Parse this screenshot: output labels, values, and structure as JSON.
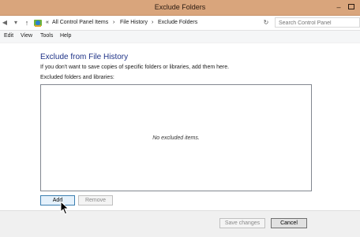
{
  "window": {
    "title": "Exclude Folders",
    "minimize_glyph": "–"
  },
  "nav": {
    "back_glyph": "◀",
    "forward_glyph": "▾",
    "up_glyph": "↑",
    "refresh_glyph": "↻"
  },
  "address": {
    "prefix": "«",
    "crumbs": [
      "All Control Panel Items",
      "File History",
      "Exclude Folders"
    ],
    "separators": [
      "›",
      "›"
    ],
    "dropdown_glyph": "⌄"
  },
  "search": {
    "placeholder": "Search Control Panel"
  },
  "menu": {
    "items": [
      "Edit",
      "View",
      "Tools",
      "Help"
    ]
  },
  "content": {
    "heading": "Exclude from File History",
    "description": "If you don't want to save copies of specific folders or libraries, add them here.",
    "list_label": "Excluded folders and libraries:",
    "empty_text": "No excluded items.",
    "add_label": "Add",
    "remove_label": "Remove"
  },
  "footer": {
    "save_label": "Save changes",
    "cancel_label": "Cancel"
  },
  "colors": {
    "titlebar": "#d9a57c",
    "heading": "#1e3287",
    "accent_border": "#3c7fb1"
  },
  "icons": [
    "back-icon",
    "forward-icon",
    "up-arrow-icon",
    "control-panel-icon",
    "dropdown-icon",
    "refresh-icon",
    "minimize-icon",
    "maximize-icon",
    "mouse-cursor-icon"
  ]
}
